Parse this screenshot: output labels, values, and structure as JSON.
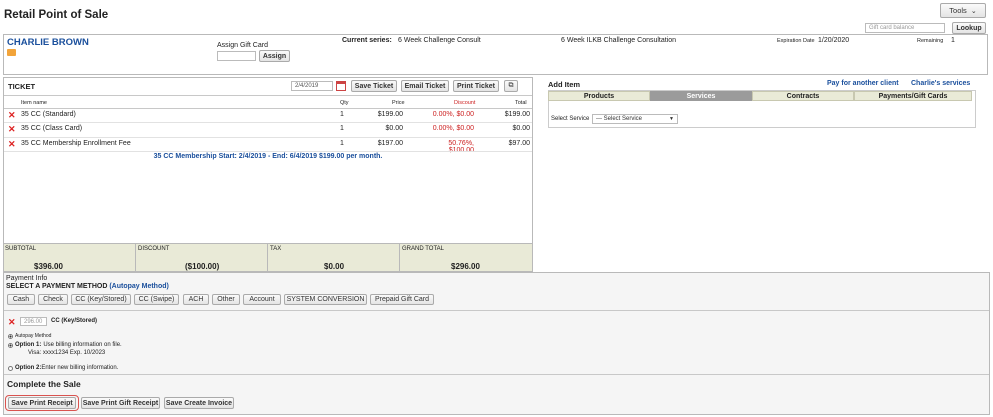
{
  "page_title": "Retail Point of Sale",
  "tools_label": "Tools",
  "gift_card_balance_placeholder": "Gift card balance",
  "lookup_label": "Lookup",
  "client": {
    "name": "CHARLIE BROWN",
    "assign_gift_card_label": "Assign Gift Card",
    "assign_button": "Assign",
    "current_series_label": "Current series:",
    "current_series_value": "6 Week Challenge Consult",
    "series_name": "6 Week ILKB Challenge Consultation",
    "expiration_label": "Expiration Date",
    "expiration_value": "1/20/2020",
    "remaining_label": "Remaining",
    "remaining_value": "1"
  },
  "ticket": {
    "title": "TICKET",
    "date": "2/4/2019",
    "save_button": "Save Ticket",
    "email_button": "Email Ticket",
    "print_button": "Print Ticket",
    "columns": {
      "item": "Item name",
      "qty": "Qty",
      "price": "Price",
      "discount": "Discount",
      "total": "Total"
    },
    "items": [
      {
        "name": "35 CC (Standard)",
        "qty": "1",
        "price": "$199.00",
        "discount": "0.00%, $0.00",
        "total": "$199.00"
      },
      {
        "name": "35 CC (Class Card)",
        "qty": "1",
        "price": "$0.00",
        "discount": "0.00%, $0.00",
        "total": "$0.00"
      },
      {
        "name": "35 CC Membership Enrollment Fee",
        "qty": "1",
        "price": "$197.00",
        "discount": "50.76%, $100.00",
        "total": "$97.00"
      }
    ],
    "membership_note": "35 CC Membership Start: 2/4/2019 - End: 6/4/2019 $199.00 per month.",
    "totals": {
      "subtotal_label": "SUBTOTAL",
      "subtotal": "$396.00",
      "discount_label": "DISCOUNT",
      "discount": "($100.00)",
      "tax_label": "TAX",
      "tax": "$0.00",
      "grand_total_label": "GRAND TOTAL",
      "grand_total": "$296.00"
    }
  },
  "add_item": {
    "title": "Add Item",
    "pay_for_another": "Pay for another client",
    "client_services": "Charlie's services",
    "tabs": [
      "Products",
      "Services",
      "Contracts",
      "Payments/Gift Cards"
    ],
    "active_tab": "Services",
    "select_service_label": "Select Service",
    "select_service_value": "--- Select Service"
  },
  "payment": {
    "info_label": "Payment Info",
    "select_label": "SELECT A PAYMENT METHOD",
    "autopay_link": "(Autopay Method)",
    "methods": [
      "Cash",
      "Check",
      "CC (Key/Stored)",
      "CC (Swipe)",
      "ACH",
      "Other",
      "Account",
      "SYSTEM CONVERSION",
      "Prepaid Gift Card"
    ],
    "amount": "296.00",
    "method_name": "CC (Key/Stored)",
    "autopay_method_label": "Autopay Method",
    "option1_bold": "Option 1:",
    "option1_text": "Use billing information on file.",
    "card_text": "Visa: xxxx1234 Exp. 10/2023",
    "option2_bold": "Option 2:",
    "option2_text": "Enter new billing information."
  },
  "complete": {
    "title": "Complete the Sale",
    "buttons": [
      "Save Print Receipt",
      "Save Print Gift Receipt",
      "Save Create Invoice"
    ]
  },
  "colors": {
    "client_name": "#1a4f9c",
    "totals_bg": "#e9ead7",
    "tab_bg": "#e9ead7",
    "active_tab_bg": "#9b9b9b",
    "discount_red": "#cc1f1f",
    "highlight_red": "#d9534f"
  }
}
